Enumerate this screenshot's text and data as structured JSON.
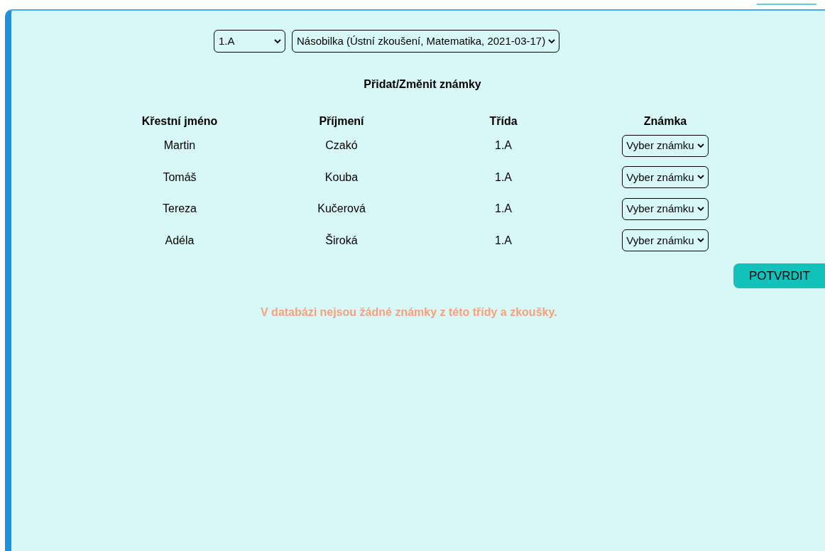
{
  "filters": {
    "class_select": {
      "value": "1.A"
    },
    "exam_select": {
      "value": "Násobilka (Ústní zkoušení, Matematika, 2021-03-17)"
    }
  },
  "heading": "Přidat/Změnit známky",
  "table": {
    "columns": [
      "Křestní jméno",
      "Příjmení",
      "Třída",
      "Známka"
    ],
    "rows": [
      {
        "first_name": "Martin",
        "last_name": "Czakó",
        "class": "1.A",
        "grade_select": "Vyber známku"
      },
      {
        "first_name": "Tomáš",
        "last_name": "Kouba",
        "class": "1.A",
        "grade_select": "Vyber známku"
      },
      {
        "first_name": "Tereza",
        "last_name": "Kučerová",
        "class": "1.A",
        "grade_select": "Vyber známku"
      },
      {
        "first_name": "Adéla",
        "last_name": "Široká",
        "class": "1.A",
        "grade_select": "Vyber známku"
      }
    ]
  },
  "confirm_button": "POTVRDIT",
  "message": "V databázi nejsou žádné známky z této třídy a zkoušky."
}
